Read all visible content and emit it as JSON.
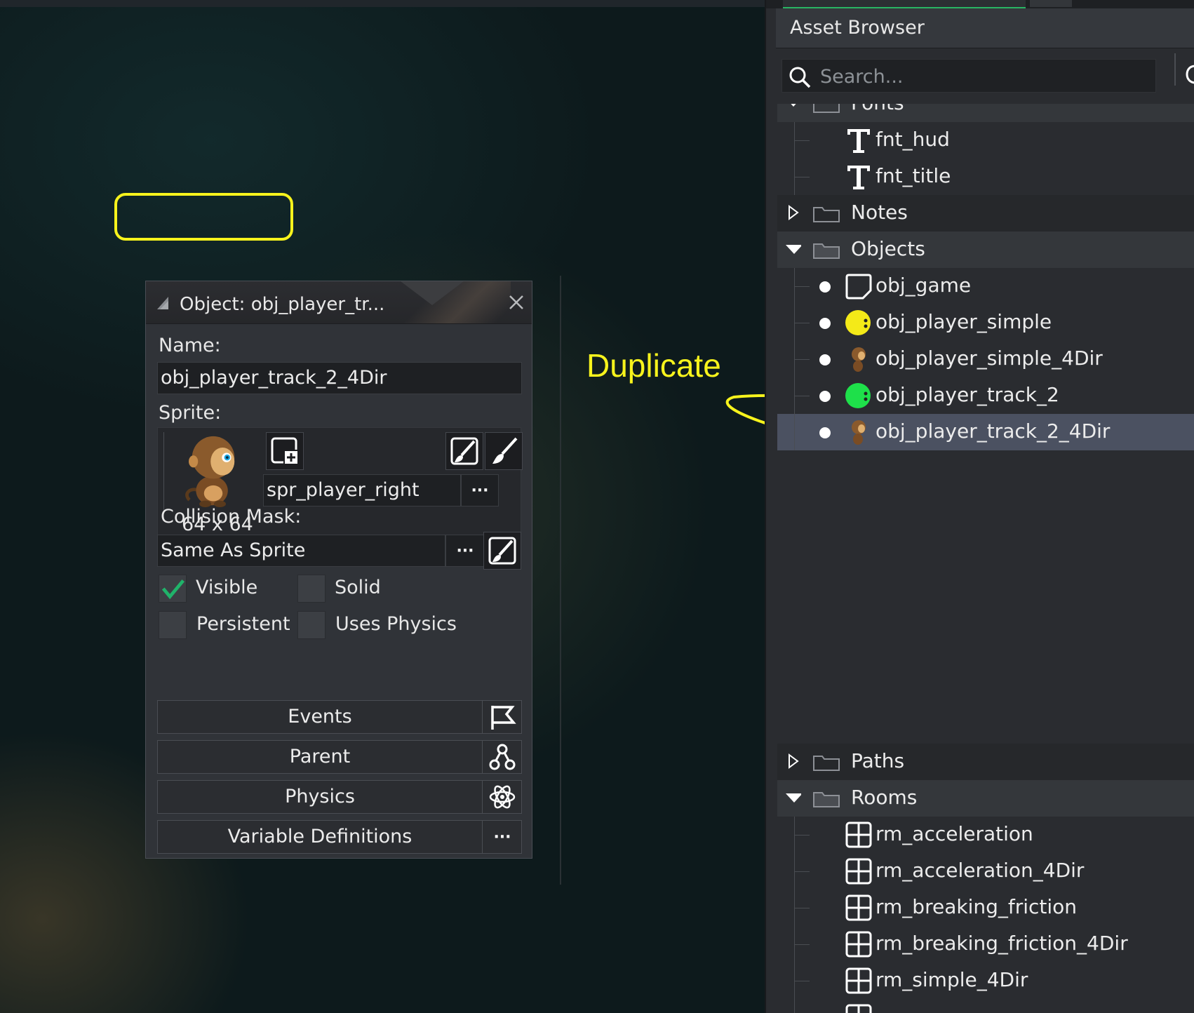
{
  "object_window": {
    "title": "Object: obj_player_tr...",
    "name_label": "Name:",
    "name_value": "obj_player_track_2_4Dir",
    "sprite_label": "Sprite:",
    "sprite_value": "spr_player_right",
    "sprite_size": "64 x 64",
    "mask_label": "Collision Mask:",
    "mask_value": "Same As Sprite",
    "dots": "···",
    "checkboxes": [
      {
        "label": "Visible",
        "checked": true
      },
      {
        "label": "Solid",
        "checked": false
      },
      {
        "label": "Persistent",
        "checked": false
      },
      {
        "label": "Uses Physics",
        "checked": false
      }
    ],
    "buttons": [
      {
        "label": "Events",
        "icon": "flag-icon"
      },
      {
        "label": "Parent",
        "icon": "hierarchy-icon"
      },
      {
        "label": "Physics",
        "icon": "atom-icon"
      },
      {
        "label": "Variable Definitions",
        "icon": "dots-icon"
      }
    ]
  },
  "annotation": {
    "text": "Duplicate",
    "color": "#f7f31c"
  },
  "asset_browser": {
    "title": "Asset Browser",
    "search_placeholder": "Search...",
    "folders": {
      "fonts": "Fonts",
      "notes": "Notes",
      "objects": "Objects",
      "paths": "Paths",
      "rooms": "Rooms"
    },
    "fonts": [
      "fnt_hud",
      "fnt_title"
    ],
    "objects": [
      {
        "name": "obj_game",
        "icon": "empty-object-icon"
      },
      {
        "name": "obj_player_simple",
        "icon": "yellow-player-sprite-icon"
      },
      {
        "name": "obj_player_simple_4Dir",
        "icon": "monkey-sprite-icon"
      },
      {
        "name": "obj_player_track_2",
        "icon": "green-player-sprite-icon"
      },
      {
        "name": "obj_player_track_2_4Dir",
        "icon": "monkey-sprite-icon",
        "selected": true
      }
    ],
    "rooms": [
      "rm_acceleration",
      "rm_acceleration_4Dir",
      "rm_breaking_friction",
      "rm_breaking_friction_4Dir",
      "rm_simple_4Dir"
    ]
  },
  "colors": {
    "accent_green": "#28b463",
    "selection": "#4b5161",
    "annotation_yellow": "#f7f31c"
  }
}
